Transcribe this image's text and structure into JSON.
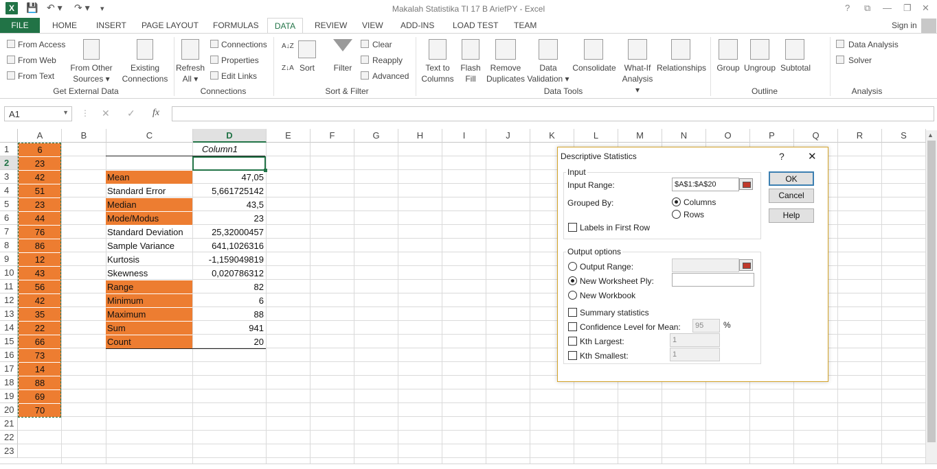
{
  "app": {
    "title": "Makalah Statistika TI 17 B AriefPY - Excel",
    "logo": "X"
  },
  "qat": {
    "save": "💾",
    "undo": "↶ ▾",
    "redo": "↷ ▾",
    "more": "▾"
  },
  "winctl": {
    "help": "?",
    "restore": "⧉",
    "minimize": "—",
    "maximize": "❐",
    "close": "✕"
  },
  "tabs": {
    "file": "FILE",
    "home": "HOME",
    "insert": "INSERT",
    "page_layout": "PAGE LAYOUT",
    "formulas": "FORMULAS",
    "data": "DATA",
    "review": "REVIEW",
    "view": "VIEW",
    "addins": "ADD-INS",
    "load_test": "LOAD TEST",
    "team": "TEAM"
  },
  "signin": "Sign in",
  "ribbon": {
    "get_external": {
      "from_access": "From Access",
      "from_web": "From Web",
      "from_text": "From Text",
      "from_other_1": "From Other",
      "from_other_2": "Sources ▾",
      "existing_1": "Existing",
      "existing_2": "Connections",
      "label": "Get External Data"
    },
    "connections": {
      "refresh_1": "Refresh",
      "refresh_2": "All ▾",
      "connections": "Connections",
      "properties": "Properties",
      "edit_links": "Edit Links",
      "label": "Connections"
    },
    "sort_filter": {
      "sort": "Sort",
      "filter": "Filter",
      "clear": "Clear",
      "reapply": "Reapply",
      "advanced": "Advanced",
      "label": "Sort & Filter"
    },
    "data_tools": {
      "ttc_1": "Text to",
      "ttc_2": "Columns",
      "flash_1": "Flash",
      "flash_2": "Fill",
      "remove_1": "Remove",
      "remove_2": "Duplicates",
      "dv_1": "Data",
      "dv_2": "Validation ▾",
      "consolidate": "Consolidate",
      "whatif_1": "What-If",
      "whatif_2": "Analysis ▾",
      "relationships": "Relationships",
      "label": "Data Tools"
    },
    "outline": {
      "group": "Group",
      "ungroup": "Ungroup",
      "subtotal": "Subtotal",
      "label": "Outline"
    },
    "analysis": {
      "data_analysis": "Data Analysis",
      "solver": "Solver",
      "label": "Analysis"
    }
  },
  "formula_bar": {
    "name_box": "A1",
    "cancel": "✕",
    "enter": "✓",
    "fx": "fx",
    "value": ""
  },
  "columns": [
    "A",
    "B",
    "C",
    "D",
    "E",
    "F",
    "G",
    "H",
    "I",
    "J",
    "K",
    "L",
    "M",
    "N",
    "O",
    "P",
    "Q",
    "R",
    "S"
  ],
  "rows": [
    "1",
    "2",
    "3",
    "4",
    "5",
    "6",
    "7",
    "8",
    "9",
    "10",
    "11",
    "12",
    "13",
    "14",
    "15",
    "16",
    "17",
    "18",
    "19",
    "20",
    "21",
    "22",
    "23"
  ],
  "col_a": [
    "6",
    "23",
    "42",
    "51",
    "23",
    "44",
    "76",
    "86",
    "12",
    "43",
    "56",
    "42",
    "35",
    "22",
    "66",
    "73",
    "14",
    "88",
    "69",
    "70"
  ],
  "stats_header": "Column1",
  "stats": [
    {
      "label": "Mean",
      "value": "47,05"
    },
    {
      "label": "Standard Error",
      "value": "5,661725142"
    },
    {
      "label": "Median",
      "value": "43,5"
    },
    {
      "label": "Mode/Modus",
      "value": "23"
    },
    {
      "label": "Standard Deviation",
      "value": "25,32000457"
    },
    {
      "label": "Sample Variance",
      "value": "641,1026316"
    },
    {
      "label": "Kurtosis",
      "value": "-1,159049819"
    },
    {
      "label": "Skewness",
      "value": "0,020786312"
    },
    {
      "label": "Range",
      "value": "82"
    },
    {
      "label": "Minimum",
      "value": "6"
    },
    {
      "label": "Maximum",
      "value": "88"
    },
    {
      "label": "Sum",
      "value": "941"
    },
    {
      "label": "Count",
      "value": "20"
    }
  ],
  "colors": {
    "orange": "#ed7d31",
    "excel_green": "#217346"
  },
  "dialog": {
    "title": "Descriptive Statistics",
    "help": "?",
    "close": "✕",
    "input_group": "Input",
    "input_range_label": "Input Range:",
    "input_range_value": "$A$1:$A$20",
    "grouped_by": "Grouped By:",
    "columns": "Columns",
    "rows": "Rows",
    "labels_first_row": "Labels in First Row",
    "output_group": "Output options",
    "output_range": "Output Range:",
    "new_ply": "New Worksheet Ply:",
    "new_workbook": "New Workbook",
    "summary": "Summary statistics",
    "confidence": "Confidence Level for Mean:",
    "confidence_value": "95",
    "percent": "%",
    "kth_largest": "Kth Largest:",
    "kth_largest_value": "1",
    "kth_smallest": "Kth Smallest:",
    "kth_smallest_value": "1",
    "ok": "OK",
    "cancel": "Cancel",
    "help_btn": "Help"
  }
}
